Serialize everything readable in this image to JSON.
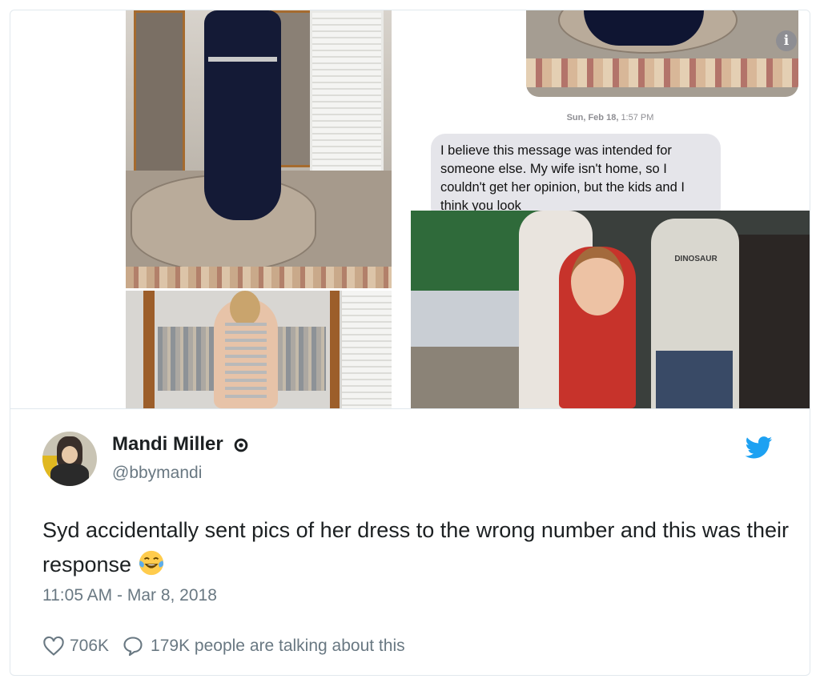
{
  "media": {
    "message": {
      "date_day": "Sun, Feb 18,",
      "date_time": "1:57 PM",
      "bubble_text": "I believe this message was intended for someone else. My wife isn't home, so I couldn't get her opinion, but the kids and I think you look",
      "info_icon": "i"
    },
    "kids_photo": {
      "shirt_text": "DINOSAUR"
    }
  },
  "tweet": {
    "author_name": "Mandi Miller",
    "author_handle": "@bbymandi",
    "text": "Syd accidentally sent pics of her dress to the wrong number and this was their response",
    "emoji": "face-with-tears-of-joy",
    "timestamp": "11:05 AM - Mar 8, 2018",
    "likes": "706K",
    "talking": "179K people are talking about this"
  },
  "icons": {
    "verified": "verified-badge-icon",
    "bird": "twitter-bird-icon",
    "heart": "heart-icon",
    "comment": "comment-bubble-icon"
  },
  "colors": {
    "twitter_blue": "#1da1f2",
    "meta_gray": "#697882",
    "bubble_gray": "#e5e5ea"
  }
}
